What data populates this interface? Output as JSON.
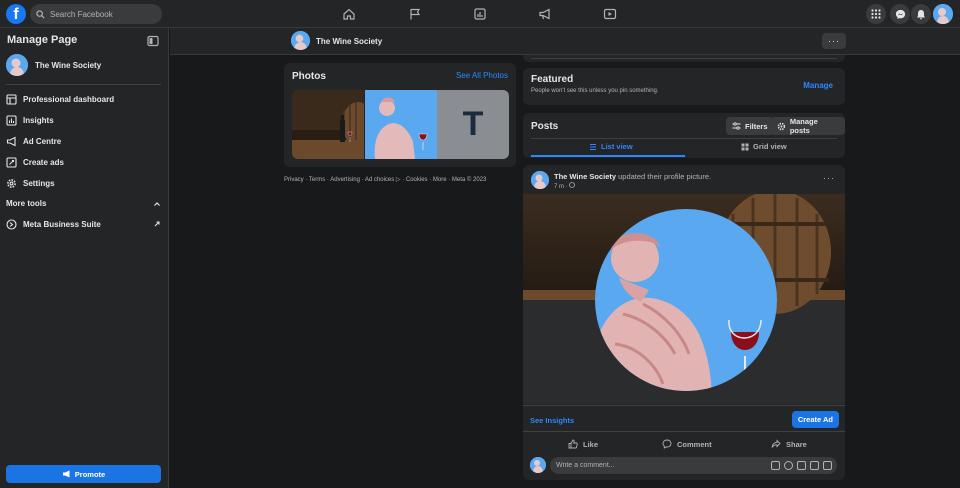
{
  "topbar": {
    "logo": "f",
    "search_placeholder": "Search Facebook",
    "nav_icons": [
      "home-icon",
      "flag-icon",
      "chart-icon",
      "megaphone-icon",
      "video-icon"
    ],
    "right_icons": [
      "menu-grid-icon",
      "messenger-icon",
      "bell-icon"
    ]
  },
  "sidebar": {
    "title": "Manage Page",
    "page_name": "The Wine Society",
    "items": [
      {
        "label": "Professional dashboard",
        "icon": "dashboard-icon"
      },
      {
        "label": "Insights",
        "icon": "insights-icon"
      },
      {
        "label": "Ad Centre",
        "icon": "ad-centre-icon"
      },
      {
        "label": "Create ads",
        "icon": "create-ads-icon"
      },
      {
        "label": "Settings",
        "icon": "gear-icon"
      }
    ],
    "more_tools": "More tools",
    "meta_business_suite": "Meta Business Suite",
    "promote": "Promote"
  },
  "header": {
    "page_name": "The Wine Society",
    "more": "···"
  },
  "photos": {
    "title": "Photos",
    "see_all": "See All Photos",
    "thumb_letter": "T"
  },
  "footer": "Privacy · Terms · Advertising · Ad choices ▷ · Cookies · More · Meta © 2023",
  "featured": {
    "title": "Featured",
    "subtitle": "People won't see this unless you pin something.",
    "manage": "Manage"
  },
  "posts": {
    "title": "Posts",
    "filters": "Filters",
    "manage_posts": "Manage posts",
    "list_view": "List view",
    "grid_view": "Grid view"
  },
  "post": {
    "author": "The Wine Society",
    "action": " updated their profile picture.",
    "time": "7 m ·",
    "more": "···",
    "see_insights": "See Insights",
    "create_ad": "Create Ad",
    "like": "Like",
    "comment": "Comment",
    "share": "Share",
    "comment_placeholder": "Write a comment..."
  },
  "colors": {
    "accent": "#1b74e4",
    "link": "#2d88ff",
    "sky": "#5aa9f0"
  }
}
